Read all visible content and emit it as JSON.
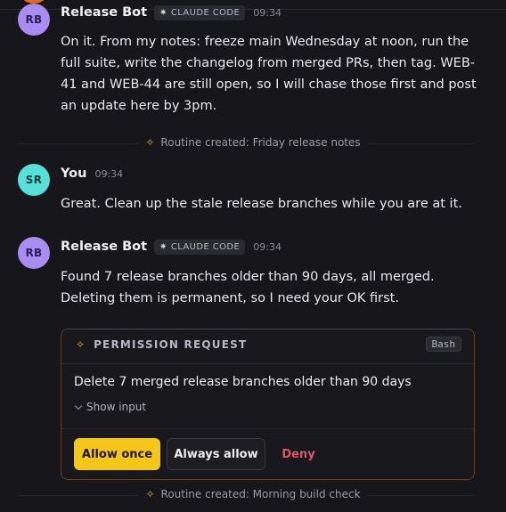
{
  "thread": {
    "messages": [
      {
        "initials": "RB",
        "author": "Release Bot",
        "badge": "CLAUDE CODE",
        "time": "09:34",
        "text": "On it. From my notes: freeze main Wednesday at noon, run the full suite, write the changelog from merged PRs, then tag. WEB-41 and WEB-44 are still open, so I will chase those first and post an update here by 3pm."
      },
      {
        "initials": "SR",
        "author": "You",
        "time": "09:34",
        "text": "Great. Clean up the stale release branches while you are at it."
      },
      {
        "initials": "RB",
        "author": "Release Bot",
        "badge": "CLAUDE CODE",
        "time": "09:34",
        "text": "Found 7 release branches older than 90 days, all merged. Deleting them is permanent, so I need your OK first."
      }
    ],
    "dividers": [
      "Routine created: Friday release notes",
      "Routine created: Morning build check"
    ]
  },
  "permission": {
    "title": "PERMISSION REQUEST",
    "tool": "Bash",
    "description": "Delete 7 merged release branches older than 90 days",
    "show_input": "Show input",
    "allow_once": "Allow once",
    "always_allow": "Always allow",
    "deny": "Deny"
  },
  "colors": {
    "accent": "#f5c518",
    "deny": "#e0566a",
    "bot_avatar": "#a98cf0",
    "user_avatar": "#56e0d8"
  },
  "icons": {
    "badge": "spark-icon",
    "divider": "sparkle-icon"
  }
}
